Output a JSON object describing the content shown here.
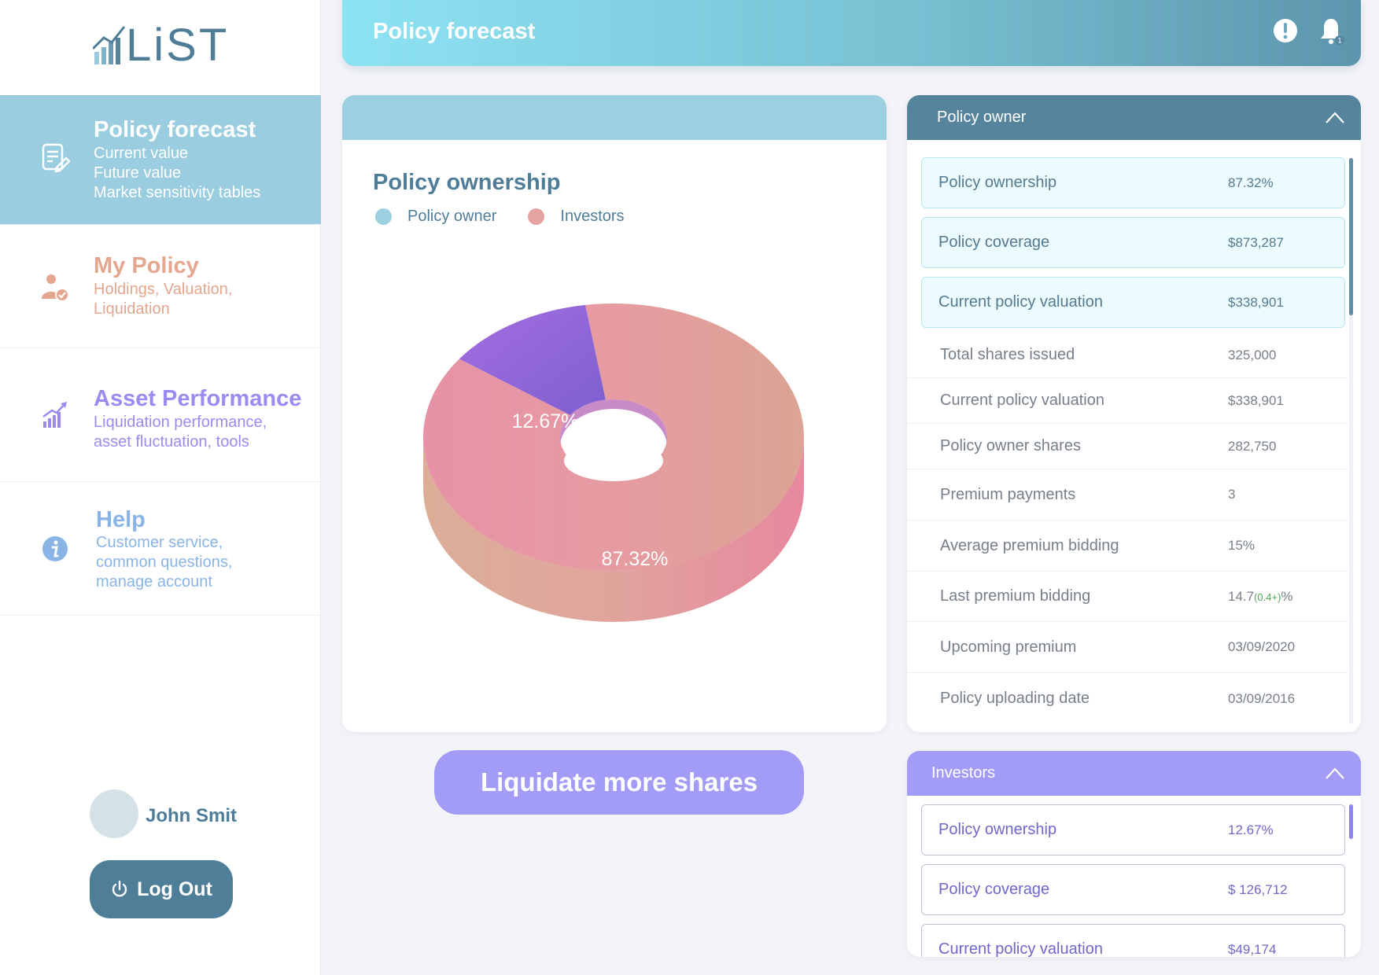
{
  "app": {
    "logo_text": "LiST"
  },
  "sidebar": {
    "items": [
      {
        "title": "Policy forecast",
        "sub": [
          "Current value",
          "Future value",
          "Market sensitivity tables"
        ],
        "icon": "document-edit-icon"
      },
      {
        "title": "My Policy",
        "sub": [
          "Holdings, Valuation,",
          "Liquidation"
        ],
        "icon": "user-check-icon"
      },
      {
        "title": "Asset Performance",
        "sub": [
          "Liquidation performance,",
          "asset fluctuation, tools"
        ],
        "icon": "growth-chart-icon"
      },
      {
        "title": "Help",
        "sub": [
          "Customer service,",
          "common questions,",
          "manage account"
        ],
        "icon": "info-icon"
      }
    ],
    "user_name": "John Smit",
    "logout_label": "Log Out"
  },
  "header": {
    "title": "Policy forecast",
    "notification_count": "1"
  },
  "chart": {
    "title": "Policy ownership",
    "legend": [
      "Policy owner",
      "Investors"
    ],
    "label_owner": "87.32%",
    "label_investors": "12.67%"
  },
  "chart_data": {
    "type": "pie",
    "title": "Policy ownership",
    "categories": [
      "Policy owner",
      "Investors"
    ],
    "values": [
      87.32,
      12.67
    ],
    "legend": "top-left",
    "colors": [
      "#e49aa8",
      "#8a6fe0"
    ]
  },
  "cta": {
    "label": "Liquidate more shares"
  },
  "owner_panel": {
    "title": "Policy owner",
    "highlight_rows": [
      {
        "label": "Policy ownership",
        "value": "87.32%"
      },
      {
        "label": "Policy coverage",
        "value": "$873,287"
      },
      {
        "label": "Current policy valuation",
        "value": "$338,901"
      }
    ],
    "rows": [
      {
        "label": "Total shares issued",
        "value": "325,000"
      },
      {
        "label": "Current policy valuation",
        "value": "$338,901"
      },
      {
        "label": "Policy owner shares",
        "value": "282,750"
      },
      {
        "label": "Premium payments",
        "value": "3"
      },
      {
        "label": "Average premium bidding",
        "value": "15%"
      },
      {
        "label": "Last premium bidding",
        "value": "14.7",
        "delta": "(0.4+)",
        "suffix": "%"
      },
      {
        "label": "Upcoming premium",
        "value": "03/09/2020"
      },
      {
        "label": "Policy uploading date",
        "value": "03/09/2016"
      }
    ]
  },
  "investors_panel": {
    "title": "Investors",
    "rows": [
      {
        "label": "Policy ownership",
        "value": "12.67%"
      },
      {
        "label": "Policy coverage",
        "value": "$ 126,712"
      },
      {
        "label": "Current policy valuation",
        "value": "$49,174"
      }
    ]
  },
  "colors": {
    "primary": "#4f7d98",
    "active_nav": "#99cddf",
    "policy": "#e4a68e",
    "asset": "#9c8af0",
    "help": "#8ab4e6",
    "cta": "#a29cf7",
    "owner_dot": "#9ccfdf",
    "investor_dot": "#e4a3a0"
  }
}
